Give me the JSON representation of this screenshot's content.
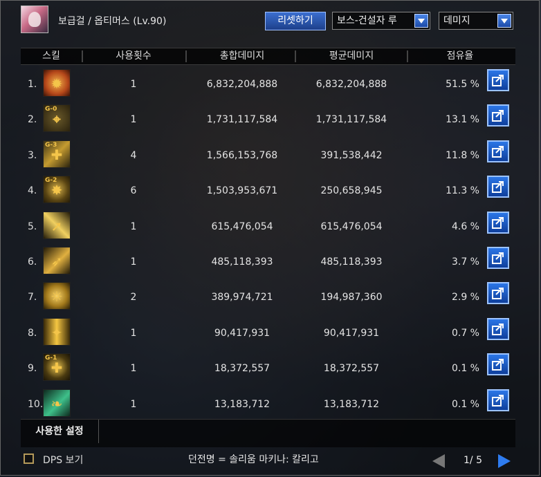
{
  "header": {
    "character": "보급걸 / 옵티머스 (Lv.90)",
    "reset_button": "리셋하기",
    "boss_select": "보스-건설자 루",
    "metric_select": "데미지"
  },
  "columns": [
    "스킬",
    "사용횟수",
    "총합데미지",
    "평균데미지",
    "점유율"
  ],
  "rows": [
    {
      "rank": "1.",
      "icon": "flame-armor-icon",
      "tag": "",
      "uses": "1",
      "total": "6,832,204,888",
      "avg": "6,832,204,888",
      "share": "51.5 %"
    },
    {
      "rank": "2.",
      "icon": "g0-target-icon",
      "tag": "G-0",
      "uses": "1",
      "total": "1,731,117,584",
      "avg": "1,731,117,584",
      "share": "13.1 %"
    },
    {
      "rank": "3.",
      "icon": "g3-grenade-icon",
      "tag": "G-3",
      "uses": "4",
      "total": "1,566,153,768",
      "avg": "391,538,442",
      "share": "11.8 %"
    },
    {
      "rank": "4.",
      "icon": "g2-mine-icon",
      "tag": "G-2",
      "uses": "6",
      "total": "1,503,953,671",
      "avg": "250,658,945",
      "share": "11.3 %"
    },
    {
      "rank": "5.",
      "icon": "rocket-blast-icon",
      "tag": "",
      "uses": "1",
      "total": "615,476,054",
      "avg": "615,476,054",
      "share": "4.6 %"
    },
    {
      "rank": "6.",
      "icon": "missile-barrage-icon",
      "tag": "",
      "uses": "1",
      "total": "485,118,393",
      "avg": "485,118,393",
      "share": "3.7 %"
    },
    {
      "rank": "7.",
      "icon": "sun-gear-icon",
      "tag": "",
      "uses": "2",
      "total": "389,974,721",
      "avg": "194,987,360",
      "share": "2.9 %"
    },
    {
      "rank": "8.",
      "icon": "burst-shot-icon",
      "tag": "",
      "uses": "1",
      "total": "90,417,931",
      "avg": "90,417,931",
      "share": "0.7 %"
    },
    {
      "rank": "9.",
      "icon": "g1-grenade-icon",
      "tag": "G-1",
      "uses": "1",
      "total": "18,372,557",
      "avg": "18,372,557",
      "share": "0.1 %"
    },
    {
      "rank": "10.",
      "icon": "green-slash-icon",
      "tag": "",
      "uses": "1",
      "total": "13,183,712",
      "avg": "13,183,712",
      "share": "0.1 %"
    }
  ],
  "footer": {
    "used_settings": "사용한 설정",
    "dps_label": "DPS 보기",
    "dungeon": "던전명 = 솔리움 마키나: 칼리고",
    "page": "1/ 5"
  }
}
